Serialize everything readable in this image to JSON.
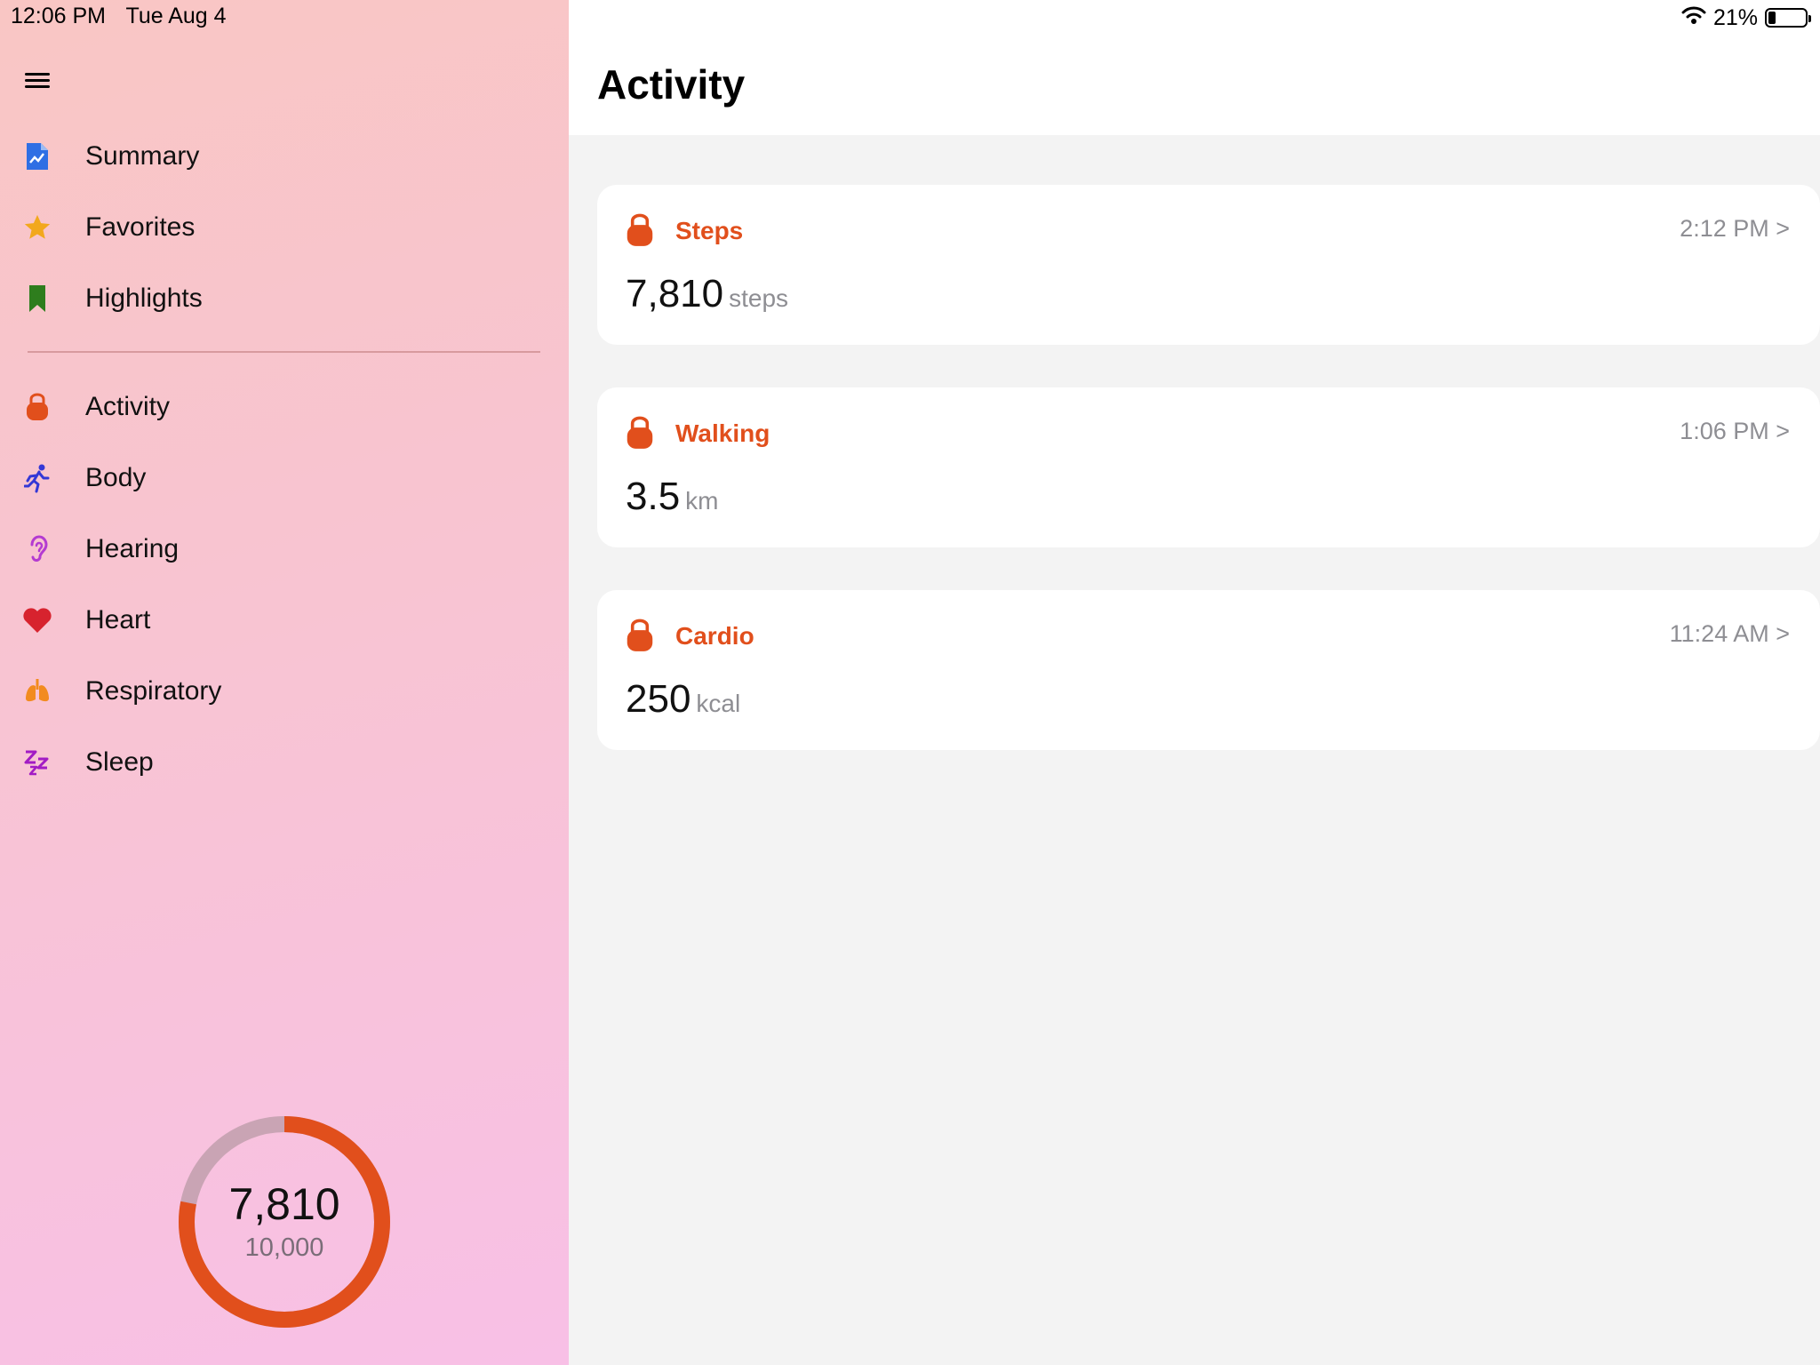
{
  "status_bar": {
    "time": "12:06 PM",
    "date": "Tue Aug 4",
    "battery": "21%",
    "battery_level": 0.21
  },
  "sidebar": {
    "top_items": [
      {
        "label": "Summary",
        "icon": "chart-document-icon",
        "color": "#2f6fe4"
      },
      {
        "label": "Favorites",
        "icon": "star-icon",
        "color": "#f2a81d"
      },
      {
        "label": "Highlights",
        "icon": "bookmark-icon",
        "color": "#2e7d1d"
      }
    ],
    "categories": [
      {
        "label": "Activity",
        "icon": "kettlebell-icon",
        "color": "#e14f1c"
      },
      {
        "label": "Body",
        "icon": "running-figure-icon",
        "color": "#3438d6"
      },
      {
        "label": "Hearing",
        "icon": "ear-icon",
        "color": "#b43bd1"
      },
      {
        "label": "Heart",
        "icon": "heart-icon",
        "color": "#d7232e"
      },
      {
        "label": "Respiratory",
        "icon": "lungs-icon",
        "color": "#f28b1f"
      },
      {
        "label": "Sleep",
        "icon": "zzz-icon",
        "color": "#a21cc4"
      }
    ],
    "progress": {
      "value": "7,810",
      "goal": "10,000",
      "fraction": 0.781,
      "color": "#e14f1c",
      "track_color": "#c9a4b4"
    }
  },
  "main": {
    "title": "Activity",
    "cards": [
      {
        "title": "Steps",
        "time": "2:12 PM >",
        "value": "7,810",
        "unit": "steps",
        "icon": "kettlebell-icon"
      },
      {
        "title": "Walking",
        "time": "1:06 PM >",
        "value": "3.5",
        "unit": "km",
        "icon": "kettlebell-icon"
      },
      {
        "title": "Cardio",
        "time": "11:24 AM >",
        "value": "250",
        "unit": "kcal",
        "icon": "kettlebell-icon"
      }
    ]
  },
  "colors": {
    "accent": "#e14f1c",
    "secondary_text": "#8e8e93"
  }
}
